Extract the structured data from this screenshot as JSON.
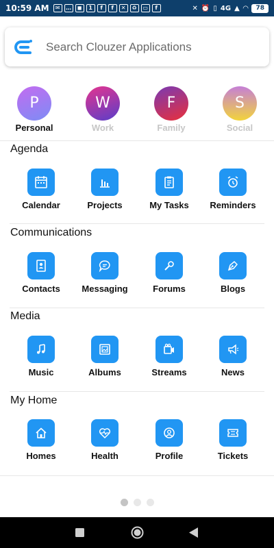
{
  "status_bar": {
    "time": "10:59 AM",
    "left_icons": [
      "✉",
      "…",
      "◼",
      "1",
      "f",
      "f",
      "✕",
      "♻",
      "▭",
      "f"
    ],
    "right_label": "4G",
    "battery": "78"
  },
  "search": {
    "placeholder": "Search Clouzer Applications",
    "logo_color": "#2196f3"
  },
  "profiles": [
    {
      "letter": "P",
      "label": "Personal",
      "active": true
    },
    {
      "letter": "W",
      "label": "Work",
      "active": false
    },
    {
      "letter": "F",
      "label": "Family",
      "active": false
    },
    {
      "letter": "S",
      "label": "Social",
      "active": false
    }
  ],
  "sections": [
    {
      "title": "Agenda",
      "apps": [
        {
          "label": "Calendar",
          "icon": "calendar-icon"
        },
        {
          "label": "Projects",
          "icon": "bar-chart-icon"
        },
        {
          "label": "My Tasks",
          "icon": "clipboard-icon"
        },
        {
          "label": "Reminders",
          "icon": "alarm-clock-icon"
        }
      ]
    },
    {
      "title": "Communications",
      "apps": [
        {
          "label": "Contacts",
          "icon": "contact-card-icon"
        },
        {
          "label": "Messaging",
          "icon": "chat-bubble-icon"
        },
        {
          "label": "Forums",
          "icon": "microphone-icon"
        },
        {
          "label": "Blogs",
          "icon": "pen-nib-icon"
        }
      ]
    },
    {
      "title": "Media",
      "apps": [
        {
          "label": "Music",
          "icon": "music-note-icon"
        },
        {
          "label": "Albums",
          "icon": "photo-album-icon"
        },
        {
          "label": "Streams",
          "icon": "video-camera-icon"
        },
        {
          "label": "News",
          "icon": "megaphone-icon"
        }
      ]
    },
    {
      "title": "My Home",
      "apps": [
        {
          "label": "Homes",
          "icon": "house-icon"
        },
        {
          "label": "Health",
          "icon": "heart-pulse-icon"
        },
        {
          "label": "Profile",
          "icon": "user-circle-icon"
        },
        {
          "label": "Tickets",
          "icon": "ticket-icon"
        }
      ]
    }
  ],
  "pager": {
    "pages": 3,
    "current": 1
  },
  "colors": {
    "accent": "#2196f3",
    "status_bar": "#0e3f6b",
    "inactive_label": "#c6c6c6"
  }
}
